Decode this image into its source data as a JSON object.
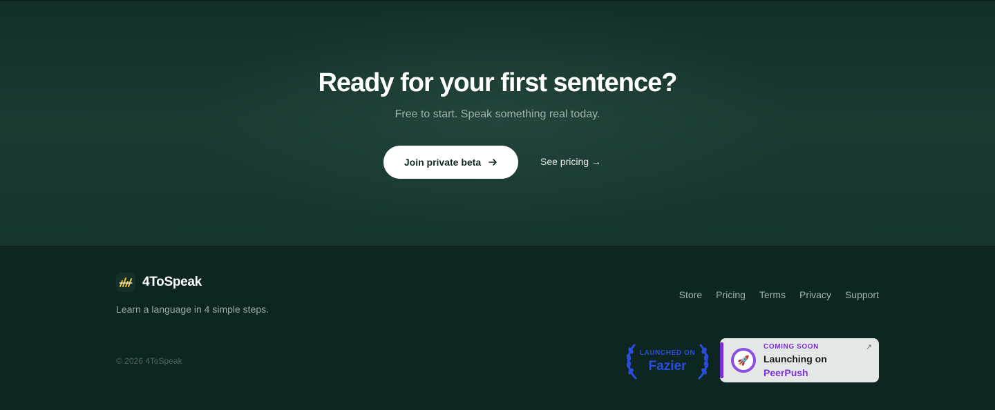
{
  "cta": {
    "title": "Ready for your first sentence?",
    "subtitle": "Free to start. Speak something real today.",
    "primary_button": "Join private beta",
    "secondary_link": "See pricing →"
  },
  "footer": {
    "brand": "4ToSpeak",
    "tagline": "Learn a language in 4 simple steps.",
    "copyright": "© 2026 4ToSpeak",
    "nav": [
      "Store",
      "Pricing",
      "Terms",
      "Privacy",
      "Support"
    ]
  },
  "badges": {
    "fazier": {
      "top": "LAUNCHED ON",
      "name": "Fazier"
    },
    "peerpush": {
      "status": "COMING SOON",
      "line": "Launching on",
      "name": "PeerPush"
    }
  },
  "colors": {
    "background": "#0e2622",
    "cta_background": "#1a3a32",
    "accent_blue": "#2a4de0",
    "accent_purple": "#7b2fd6",
    "logo_yellow": "#f2c230"
  },
  "icons": {
    "primary_button": "arrow-right-icon",
    "logo": "bar-chart-logo-icon",
    "peerpush": "rocket-icon",
    "external": "external-link-icon",
    "laurel": "laurel-icon"
  }
}
